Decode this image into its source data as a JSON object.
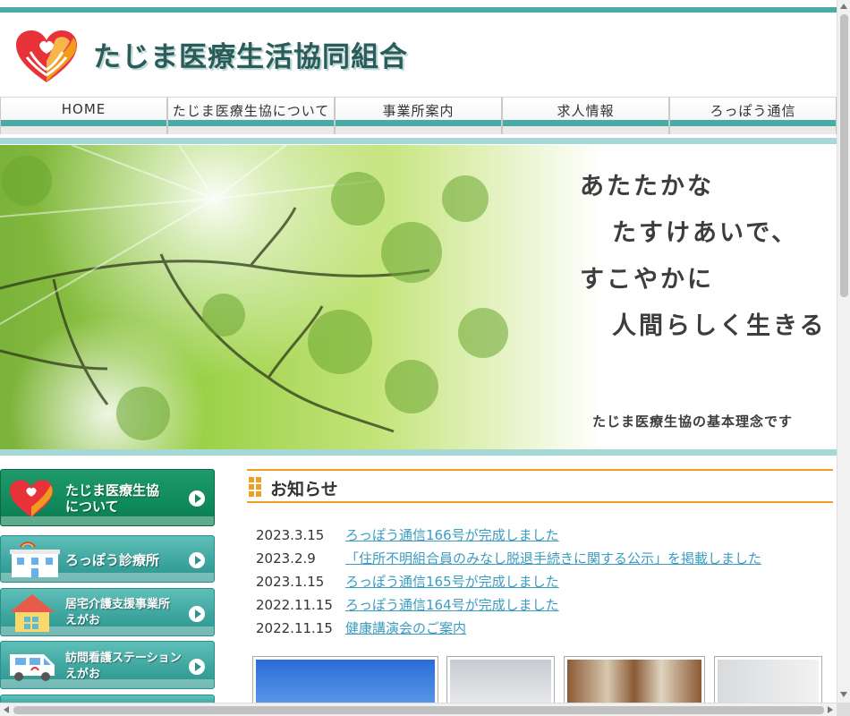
{
  "header": {
    "site_title": "たじま医療生活協同組合"
  },
  "nav": {
    "items": [
      "HOME",
      "たじま医療生協について",
      "事業所案内",
      "求人情報",
      "ろっぽう通信"
    ]
  },
  "hero": {
    "catch": [
      "あたたかな",
      "たすけあいで、",
      "すこやかに",
      "人間らしく生きる"
    ],
    "sub": "たじま医療生協の基本理念です"
  },
  "side": {
    "btn1": [
      "たじま医療生協",
      "について"
    ],
    "btn2": "ろっぽう診療所",
    "btn3": [
      "居宅介護支援事業所",
      "えがお"
    ],
    "btn4": [
      "訪問看護ステーション",
      "えがお"
    ]
  },
  "news": {
    "title": "お知らせ",
    "items": [
      {
        "date": "2023.3.15",
        "text": "ろっぽう通信166号が完成しました"
      },
      {
        "date": "2023.2.9",
        "text": "「住所不明組合員のみなし脱退手続きに関する公示」を掲載しました"
      },
      {
        "date": "2023.1.15",
        "text": "ろっぽう通信165号が完成しました"
      },
      {
        "date": "2022.11.15",
        "text": "ろっぽう通信164号が完成しました"
      },
      {
        "date": "2022.11.15",
        "text": "健康講演会のご案内"
      }
    ]
  },
  "colors": {
    "accent": "#4aaaa5",
    "news_border": "#f0a020",
    "link": "#3a9cc0",
    "side_dark": "#108a5b",
    "side_teal": "#3ba49d"
  },
  "icons": [
    "heart-hands-logo-icon",
    "clinic-building-icon",
    "house-icon",
    "van-icon",
    "arrow-right-icon"
  ]
}
